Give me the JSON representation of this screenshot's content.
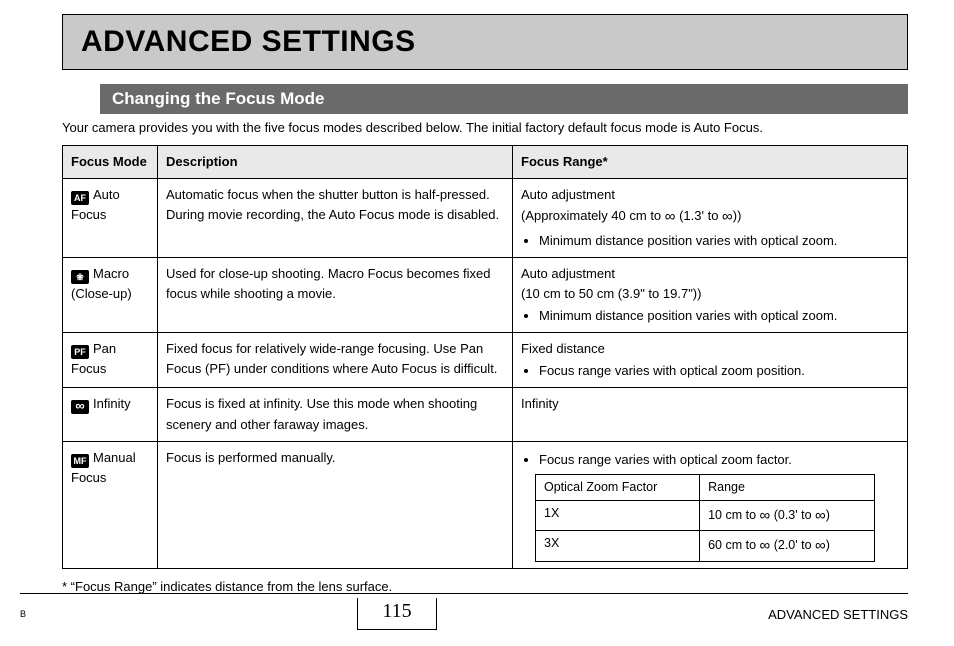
{
  "title": "ADVANCED SETTINGS",
  "section_title": "Changing the Focus Mode",
  "intro": "Your camera provides you with the five focus modes described below. The initial factory default focus mode is Auto Focus.",
  "headers": {
    "mode": "Focus Mode",
    "desc": "Description",
    "range": "Focus Range*"
  },
  "rows": {
    "auto": {
      "icon": "AF",
      "label": "Auto Focus",
      "desc": "Automatic focus when the shutter button is half-pressed. During movie recording, the Auto Focus mode is disabled.",
      "range_line": "Auto adjustment",
      "range_paren_pre": "(Approximately 40 cm to ",
      "range_paren_mid": " (1.3' to ",
      "range_paren_post": "))",
      "bullet": "Minimum distance position varies with optical zoom."
    },
    "macro": {
      "icon": "❀",
      "label": "Macro (Close-up)",
      "desc": "Used for close-up shooting. Macro Focus becomes fixed focus while shooting a movie.",
      "range_line": "Auto adjustment",
      "range_paren": "(10 cm to 50 cm (3.9\" to 19.7\"))",
      "bullet": "Minimum distance position varies with optical zoom."
    },
    "pan": {
      "icon": "PF",
      "label": "Pan Focus",
      "desc": "Fixed focus for relatively wide-range focusing. Use Pan Focus (PF) under conditions where Auto Focus is difficult.",
      "range_line": "Fixed distance",
      "bullet": "Focus range varies with optical zoom position."
    },
    "infinity": {
      "icon": "∞",
      "label": "Infinity",
      "desc": "Focus is fixed at infinity. Use this mode when shooting scenery and other faraway images.",
      "range_line": "Infinity"
    },
    "manual": {
      "icon": "MF",
      "label": "Manual Focus",
      "desc": "Focus is performed manually.",
      "bullet": "Focus range varies with optical zoom factor.",
      "sub_headers": {
        "factor": "Optical Zoom Factor",
        "range": "Range"
      },
      "sub_rows": {
        "r1": {
          "factor": "1X",
          "pre": "10 cm to ",
          "mid": " (0.3' to ",
          "post": ")"
        },
        "r2": {
          "factor": "3X",
          "pre": "60 cm to ",
          "mid": " (2.0' to ",
          "post": ")"
        }
      }
    }
  },
  "footnote": "* “Focus Range” indicates distance from the lens surface.",
  "footer": {
    "b": "B",
    "page": "115",
    "right": "ADVANCED SETTINGS"
  },
  "sym": {
    "inf": "∞"
  }
}
